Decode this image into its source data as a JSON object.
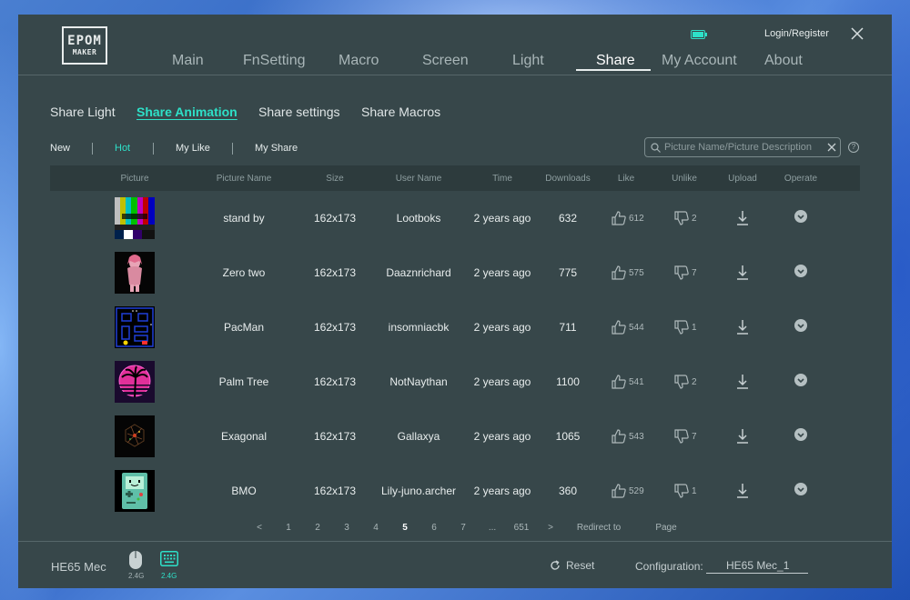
{
  "app": {
    "logo_line1": "EPOM",
    "logo_line2": "MAKER",
    "login_label": "Login/Register"
  },
  "nav": {
    "items": [
      {
        "label": "Main"
      },
      {
        "label": "FnSetting"
      },
      {
        "label": "Macro"
      },
      {
        "label": "Screen"
      },
      {
        "label": "Light"
      },
      {
        "label": "Share",
        "active": true
      },
      {
        "label": "My Account"
      },
      {
        "label": "About"
      }
    ]
  },
  "subtabs": [
    {
      "label": "Share Light"
    },
    {
      "label": "Share Animation",
      "active": true
    },
    {
      "label": "Share settings"
    },
    {
      "label": "Share Macros"
    }
  ],
  "filters": [
    {
      "label": "New"
    },
    {
      "label": "Hot",
      "active": true
    },
    {
      "label": "My Like"
    },
    {
      "label": "My Share"
    }
  ],
  "search": {
    "placeholder": "Picture Name/Picture Description"
  },
  "help_label": "?",
  "table": {
    "columns": [
      "Picture",
      "Picture Name",
      "Size",
      "User Name",
      "Time",
      "Downloads",
      "Like",
      "Unlike",
      "Upload",
      "Operate"
    ],
    "rows": [
      {
        "name": "stand by",
        "size": "162x173",
        "user": "Lootboks",
        "time": "2 years ago",
        "downloads": "632",
        "likes": "612",
        "unlikes": "2",
        "thumb": "color-bars"
      },
      {
        "name": "Zero two",
        "size": "162x173",
        "user": "Daaznrichard",
        "time": "2 years ago",
        "downloads": "775",
        "likes": "575",
        "unlikes": "7",
        "thumb": "anime-girl"
      },
      {
        "name": "PacMan",
        "size": "162x173",
        "user": "insomniacbk",
        "time": "2 years ago",
        "downloads": "711",
        "likes": "544",
        "unlikes": "1",
        "thumb": "pacman-maze"
      },
      {
        "name": "Palm Tree",
        "size": "162x173",
        "user": "NotNaythan",
        "time": "2 years ago",
        "downloads": "1100",
        "likes": "541",
        "unlikes": "2",
        "thumb": "palm-sunset"
      },
      {
        "name": "Exagonal",
        "size": "162x173",
        "user": "Gallaxya",
        "time": "2 years ago",
        "downloads": "1065",
        "likes": "543",
        "unlikes": "7",
        "thumb": "dark-hexagon"
      },
      {
        "name": "BMO",
        "size": "162x173",
        "user": "Lily-juno.archer",
        "time": "2 years ago",
        "downloads": "360",
        "likes": "529",
        "unlikes": "1",
        "thumb": "bmo-robot"
      }
    ]
  },
  "pagination": {
    "prev": "<",
    "pages": [
      "1",
      "2",
      "3",
      "4",
      "5",
      "6",
      "7",
      "...",
      "651"
    ],
    "current": "5",
    "next": ">",
    "redirect_label": "Redirect to",
    "page_label": "Page"
  },
  "footer": {
    "device_name": "HE65 Mec",
    "mouse_label": "2.4G",
    "keyboard_label": "2.4G",
    "reset_label": "Reset",
    "config_label": "Configuration:",
    "config_value": "HE65 Mec_1"
  },
  "colors": {
    "accent": "#2ee0c8",
    "panel": "#37474a",
    "table_header": "#2d3b3d"
  }
}
